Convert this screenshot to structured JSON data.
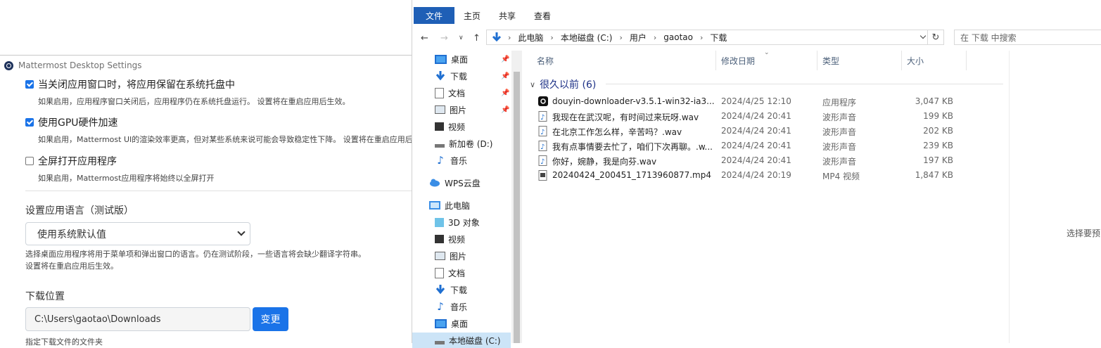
{
  "mattermost": {
    "title": "Mattermost Desktop Settings",
    "opt1": {
      "label": "当关闭应用窗口时，将应用保留在系统托盘中",
      "desc": "如果启用，应用程序窗口关闭后，应用程序仍在系统托盘运行。 设置将在重启应用后生效。",
      "checked": true
    },
    "opt2": {
      "label": "使用GPU硬件加速",
      "desc": "如果启用，Mattermost UI的渲染效率更高，但对某些系统来说可能会导致稳定性下降。 设置将在重启应用后生",
      "checked": true
    },
    "opt3": {
      "label": "全屏打开应用程序",
      "desc": "如果启用，Mattermost应用程序将始终以全屏打开",
      "checked": false
    },
    "language": {
      "heading": "设置应用语言（测试版）",
      "selected": "使用系统默认值",
      "hint1": "选择桌面应用程序将用于菜单项和弹出窗口的语言。仍在测试阶段，一些语言将会缺少翻译字符串。",
      "hint2": "设置将在重启应用后生效。"
    },
    "download": {
      "heading": "下载位置",
      "path": "C:\\Users\\gaotao\\Downloads",
      "change": "变更",
      "hint": "指定下载文件的文件夹"
    }
  },
  "explorer": {
    "ribbon": [
      "文件",
      "主页",
      "共享",
      "查看"
    ],
    "breadcrumb": [
      "此电脑",
      "本地磁盘 (C:)",
      "用户",
      "gaotao",
      "下载"
    ],
    "search_placeholder": "在 下载 中搜索",
    "nav": [
      {
        "label": "桌面",
        "icon": "desktop-icon",
        "pinned": true
      },
      {
        "label": "下载",
        "icon": "download-icon",
        "pinned": true
      },
      {
        "label": "文档",
        "icon": "document-icon",
        "pinned": true
      },
      {
        "label": "图片",
        "icon": "picture-icon",
        "pinned": true
      },
      {
        "label": "视频",
        "icon": "video-icon",
        "pinned": false
      },
      {
        "label": "新加卷 (D:)",
        "icon": "drive-icon",
        "pinned": false
      },
      {
        "label": "音乐",
        "icon": "music-icon",
        "pinned": false
      },
      {
        "label": "WPS云盘",
        "icon": "cloud-icon",
        "pinned": false
      },
      {
        "label": "此电脑",
        "icon": "computer-icon",
        "pinned": false
      },
      {
        "label": "3D 对象",
        "icon": "3d-objects-icon",
        "pinned": false
      },
      {
        "label": "视频",
        "icon": "video-icon",
        "pinned": false
      },
      {
        "label": "图片",
        "icon": "picture-icon",
        "pinned": false
      },
      {
        "label": "文档",
        "icon": "document-icon",
        "pinned": false
      },
      {
        "label": "下载",
        "icon": "download-icon",
        "pinned": false
      },
      {
        "label": "音乐",
        "icon": "music-icon",
        "pinned": false
      },
      {
        "label": "桌面",
        "icon": "desktop-icon",
        "pinned": false
      },
      {
        "label": "本地磁盘 (C:)",
        "icon": "drive-icon",
        "pinned": false
      }
    ],
    "columns": {
      "name": "名称",
      "date": "修改日期",
      "type": "类型",
      "size": "大小"
    },
    "group": "很久以前 (6)",
    "files": [
      {
        "name": "douyin-downloader-v3.5.1-win32-ia3...",
        "date": "2024/4/25 12:10",
        "type": "应用程序",
        "size": "3,047 KB",
        "icon": "app-icon"
      },
      {
        "name": "我现在在武汉呢，有时间过来玩呀.wav",
        "date": "2024/4/24 20:41",
        "type": "波形声音",
        "size": "199 KB",
        "icon": "audio-file-icon"
      },
      {
        "name": "在北京工作怎么样，辛苦吗？.wav",
        "date": "2024/4/24 20:41",
        "type": "波形声音",
        "size": "202 KB",
        "icon": "audio-file-icon"
      },
      {
        "name": "我有点事情要去忙了，咱们下次再聊。.w...",
        "date": "2024/4/24 20:41",
        "type": "波形声音",
        "size": "239 KB",
        "icon": "audio-file-icon"
      },
      {
        "name": "你好，婉静，我是向芬.wav",
        "date": "2024/4/24 20:41",
        "type": "波形声音",
        "size": "197 KB",
        "icon": "audio-file-icon"
      },
      {
        "name": "20240424_200451_1713960877.mp4",
        "date": "2024/4/24 20:19",
        "type": "MP4 视频",
        "size": "1,847 KB",
        "icon": "video-file-icon"
      }
    ],
    "preview_hint": "选择要预"
  },
  "colors": {
    "accent": "#1a73e8",
    "ribbon_file": "#1f5fb6",
    "group_header": "#1e3287"
  }
}
